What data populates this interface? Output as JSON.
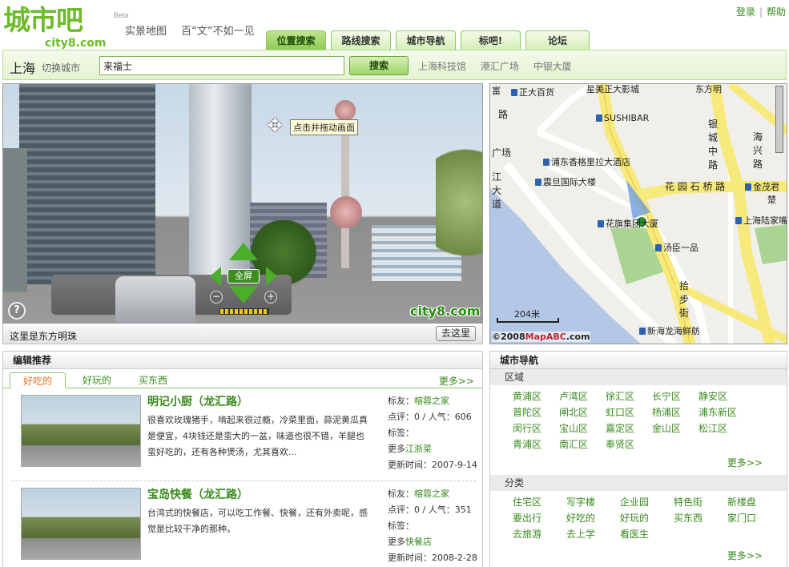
{
  "header": {
    "logo_cn": "城市吧",
    "logo_en": "city8.com",
    "beta": "Beta",
    "slogan_1": "实景地图",
    "slogan_2": "百“文”不如一见",
    "login": "登录",
    "separator": "|",
    "help": "帮助"
  },
  "tabs": [
    {
      "label": "位置搜索",
      "active": true
    },
    {
      "label": "路线搜索",
      "active": false
    },
    {
      "label": "城市导航",
      "active": false
    },
    {
      "label": "标吧!",
      "active": false
    },
    {
      "label": "论坛",
      "active": false
    }
  ],
  "search": {
    "city": "上海",
    "switch_city": "切换城市",
    "query": "来福士",
    "button": "搜索",
    "quick_links": [
      "上海科技馆",
      "港汇广场",
      "中银大厦"
    ]
  },
  "street_view": {
    "tooltip": "点击并拖动画面",
    "fullscreen": "全屏",
    "zoom_in": "+",
    "zoom_out": "−",
    "help": "?",
    "watermark": "city8.com",
    "caption": "这里是东方明珠",
    "go_here": "去这里"
  },
  "map": {
    "labels": {
      "zhengda": "正大百货",
      "sushibar": "SUSHIBAR",
      "shangri_la": "浦东香格里拉大酒店",
      "fudan": "震旦国际大楼",
      "huaqi": "花旗集团大厦",
      "tangchen": "汤臣一品",
      "jinmao": "金茂君",
      "lujiazui": "上海陆家嘴",
      "xinhailong": "新海龙海鲜舫",
      "huayuanshiqiao": "花 园 石 桥 路",
      "yincheng": "银城中路",
      "haixing": "海兴路",
      "jiangda": "江大道",
      "shibu": "拾步街",
      "lu": "路",
      "chang": "广场",
      "top_left": "富",
      "top_mid": "星美正大影城",
      "top_mid2": "东方明",
      "chu": "楚"
    },
    "scale": "204米",
    "copyright": "©2008",
    "copyright_brand": "MapABC",
    "copyright_tld": ".com"
  },
  "editor": {
    "title": "编辑推荐",
    "tabs": [
      "好吃的",
      "好玩的",
      "买东西"
    ],
    "more": "更多>>",
    "items": [
      {
        "title": "明记小厨（龙汇路）",
        "desc": "很喜欢玫瑰猪手，啃起来很过瘾，冷菜里面，蒜泥黄瓜真是便宜，4块钱还是蛮大的一盆，味道也很不错，羊腿也蛮好吃的，还有各种煲汤，尤其喜欢...",
        "friend_label": "标友：",
        "friend": "榕蓉之家",
        "rating": "点评：0 / 人气：606",
        "tags_label": "标签：",
        "more_label": "更多",
        "more_value": "江浙菜",
        "updated": "更新时间：2007-9-14"
      },
      {
        "title": "宝岛快餐（龙汇路）",
        "desc": "台湾式的快餐店，可以吃工作餐、快餐，还有外卖呢，感觉是比较干净的那种。",
        "friend_label": "标友：",
        "friend": "榕蓉之家",
        "rating": "点评：0 / 人气：351",
        "tags_label": "标签：",
        "more_label": "更多",
        "more_value": "快餐店",
        "updated": "更新时间：2008-2-28"
      }
    ]
  },
  "city_nav": {
    "title": "城市导航",
    "district_header": "区域",
    "districts": [
      "黄浦区",
      "卢湾区",
      "徐汇区",
      "长宁区",
      "静安区",
      "普陀区",
      "闸北区",
      "虹口区",
      "杨浦区",
      "浦东新区",
      "闵行区",
      "宝山区",
      "嘉定区",
      "金山区",
      "松江区",
      "青浦区",
      "南汇区",
      "奉贤区"
    ],
    "category_header": "分类",
    "categories": [
      "住宅区",
      "写字楼",
      "企业园",
      "特色街",
      "新楼盘",
      "要出行",
      "好吃的",
      "好玩的",
      "买东西",
      "家门口",
      "去旅游",
      "去上学",
      "看医生"
    ],
    "more": "更多>>"
  },
  "colors": {
    "brand_green": "#6dbb2b",
    "link_green": "#3a8a1e",
    "highlight_orange": "#f37021",
    "map_road": "#f7e97a"
  }
}
